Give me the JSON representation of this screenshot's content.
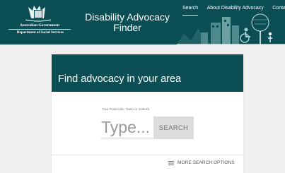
{
  "header": {
    "gov_name": "Australian Government",
    "dept_name": "Department of Social Services",
    "site_title": "Disability Advocacy Finder",
    "nav": [
      {
        "label": "Search"
      },
      {
        "label": "About Disability Advocacy"
      },
      {
        "label": "Contact"
      }
    ]
  },
  "search": {
    "heading": "Find advocacy in your area",
    "field_label": "Your Postcode, Town or Suburb",
    "placeholder": "Type...",
    "button_label": "SEARCH",
    "more_options_label": "MORE SEARCH OPTIONS"
  },
  "colors": {
    "brand": "#0b4f55",
    "background": "#efefef"
  }
}
